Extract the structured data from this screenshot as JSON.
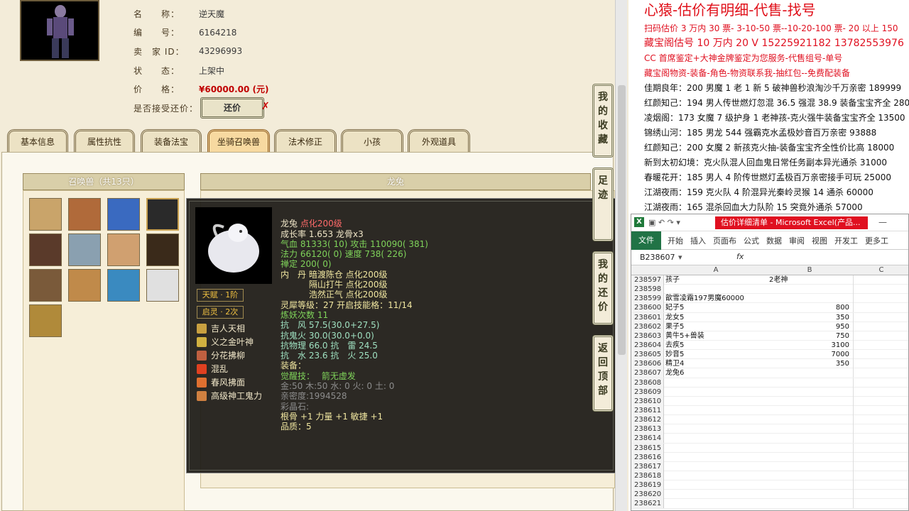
{
  "listing": {
    "fields": [
      {
        "label": "名　　称：",
        "value": "逆天魔"
      },
      {
        "label": "编　　号：",
        "value": "6164218"
      },
      {
        "label": "卖　家 ID：",
        "value": "43296993"
      },
      {
        "label": "状　　态：",
        "value": "上架中"
      },
      {
        "label": "价　　格：",
        "value": "¥60000.00 (元)"
      },
      {
        "label": "是否接受还价：",
        "value": ""
      }
    ],
    "bargain_button": "还价",
    "bargain_x": "✗"
  },
  "tabs": [
    "基本信息",
    "属性抗性",
    "装备法宝",
    "坐骑召唤兽",
    "法术修正",
    "小孩",
    "外观道具"
  ],
  "active_tab": "坐骑召唤兽",
  "pets_panel": {
    "title": "召唤兽（共13只）",
    "count": 13
  },
  "pet_panel_title": "龙兔",
  "tooltip": {
    "name": "龙兔",
    "name_suffix": "点化200级",
    "badges": [
      "天赋 · 1阶",
      "启灵 · 2次"
    ],
    "skills": [
      "吉人天相",
      "义之金叶神",
      "分花拂柳",
      "混乱",
      "春风拂面",
      "高级神工鬼力"
    ],
    "lines": [
      "成长率 1.653 龙骨x3",
      "气血 81333( 10) 攻击 110090( 381)",
      "法力 66120( 0) 速度 738( 226)",
      "禅定 200( 0)",
      "内　丹 暗渡陈仓 点化200级",
      "　　　 隔山打牛 点化200级",
      "　　　 浩然正气 点化200级",
      "灵犀等级：27 开启技能格：11/14",
      "炼妖次数 11",
      "抗　风 57.5(30.0+27.5)",
      "抗鬼火 30.0(30.0+0.0)",
      "抗物理 66.0 抗　雷 24.5",
      "抗　水 23.6 抗　火 25.0",
      "",
      "装备：",
      "觉醒技：　 箭无虚发",
      "金:50 木:50 水: 0 火: 0 土: 0",
      "亲密度:1994528",
      "",
      "彩晶石:",
      "根骨 +1 力量 +1 敏捷 +1",
      "品质：5"
    ]
  },
  "side_buttons": [
    "我的收藏",
    "足迹",
    "我的还价",
    "返回顶部"
  ],
  "notes": {
    "title": "心猿-估价有明细-代售-找号",
    "red_lines": [
      "扫码估价 3 万内 30 票- 3-10-50 票--10-20-100 票- 20 以上 150",
      "藏宝阁估号 10 万内 20 V 15225921182  13782553976",
      "CC 首席鉴定+大神金牌鉴定为您服务-代售组号-单号",
      "藏宝阁物资-装备-角色-物资联系我-抽红包--免费配装备"
    ],
    "black_lines": [
      "佳期良年：200 男魔 1 老 1 新 5 破神兽秒浪淘沙千万亲密 189999",
      "红颜知己：194 男人传世燃灯忽混 36.5 强混 38.9 装备宝宝齐全 28000",
      "凌烟阁：173 女魔 7 级护身 1 老神孩-克火强牛装备宝宝齐全 13500",
      "锦绣山河：185 男龙 544 强霸克水孟极妙音百万亲密 93888",
      "红颜知己：200 女魔 2 新孩克火抽-装备宝宝齐全性价比高 18000",
      "新到太初幻境：克火队混人回血鬼日常任务副本异光通杀 31000",
      "春暖花开：185 男人 4 阶传世燃灯孟极百万亲密接手可玩 25000",
      "江湖夜雨：159 克火队 4 阶混异光秦岭灵猴 14 通杀 60000",
      "江湖夜雨：165 混杀回血大力队阶 15 突竟外通杀 57000"
    ]
  },
  "excel": {
    "app_title": "估价详细清单 - Microsoft Excel(产品...",
    "file_tab": "文件",
    "ribbon_tabs": [
      "开始",
      "插入",
      "页面布",
      "公式",
      "数据",
      "审阅",
      "视图",
      "开发工",
      "更多工"
    ],
    "name_box": "B238607",
    "fx": "fx",
    "columns": [
      "A",
      "B",
      "C"
    ],
    "rows": [
      {
        "n": "238597",
        "a": "孩子",
        "b": "2老神",
        "b_text": true
      },
      {
        "n": "238598",
        "a": "",
        "b": ""
      },
      {
        "n": "238599",
        "a": "歆雪凌霜197男魔60000",
        "b": ""
      },
      {
        "n": "238600",
        "a": "妃子5",
        "b": "800"
      },
      {
        "n": "238601",
        "a": "龙女5",
        "b": "350"
      },
      {
        "n": "238602",
        "a": "果子5",
        "b": "950"
      },
      {
        "n": "238603",
        "a": "黄牛5+兽装",
        "b": "750"
      },
      {
        "n": "238604",
        "a": "去疾5",
        "b": "3100"
      },
      {
        "n": "238605",
        "a": "妙音5",
        "b": "7000"
      },
      {
        "n": "238606",
        "a": "精卫4",
        "b": "350"
      },
      {
        "n": "238607",
        "a": "龙兔6",
        "b": ""
      },
      {
        "n": "238608",
        "a": "",
        "b": ""
      },
      {
        "n": "238609",
        "a": "",
        "b": ""
      },
      {
        "n": "238610",
        "a": "",
        "b": ""
      },
      {
        "n": "238611",
        "a": "",
        "b": ""
      },
      {
        "n": "238612",
        "a": "",
        "b": ""
      },
      {
        "n": "238613",
        "a": "",
        "b": ""
      },
      {
        "n": "238614",
        "a": "",
        "b": ""
      },
      {
        "n": "238615",
        "a": "",
        "b": ""
      },
      {
        "n": "238616",
        "a": "",
        "b": ""
      },
      {
        "n": "238617",
        "a": "",
        "b": ""
      },
      {
        "n": "238618",
        "a": "",
        "b": ""
      },
      {
        "n": "238619",
        "a": "",
        "b": ""
      },
      {
        "n": "238620",
        "a": "",
        "b": ""
      },
      {
        "n": "238621",
        "a": "",
        "b": ""
      }
    ]
  },
  "colors": {
    "price": "#c00000",
    "note_red": "#e01020",
    "excel_green": "#217346"
  }
}
